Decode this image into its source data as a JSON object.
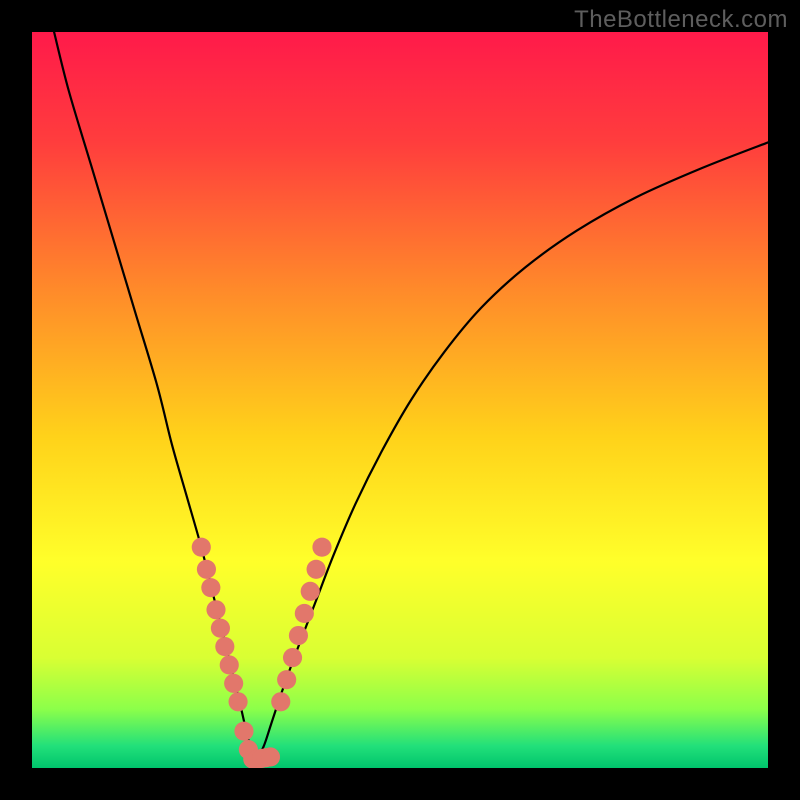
{
  "watermark": "TheBottleneck.com",
  "chart_data": {
    "type": "line",
    "title": "",
    "xlabel": "",
    "ylabel": "",
    "xlim": [
      0,
      100
    ],
    "ylim": [
      0,
      100
    ],
    "grid": false,
    "legend": false,
    "background_gradient": {
      "stops": [
        {
          "offset": 0.0,
          "color": "#ff1a4a"
        },
        {
          "offset": 0.15,
          "color": "#ff3d3d"
        },
        {
          "offset": 0.35,
          "color": "#ff8a2a"
        },
        {
          "offset": 0.55,
          "color": "#ffd21a"
        },
        {
          "offset": 0.72,
          "color": "#ffff2a"
        },
        {
          "offset": 0.85,
          "color": "#d9ff33"
        },
        {
          "offset": 0.92,
          "color": "#8cff4a"
        },
        {
          "offset": 0.97,
          "color": "#22e07a"
        },
        {
          "offset": 1.0,
          "color": "#00c46c"
        }
      ]
    },
    "series": [
      {
        "name": "bottleneck-curve",
        "color": "#000000",
        "x": [
          3,
          5,
          8,
          11,
          14,
          17,
          19,
          21,
          23,
          24.5,
          26,
          27.2,
          28.2,
          29,
          29.6,
          30,
          30.5,
          31.5,
          32.5,
          34,
          36,
          38.5,
          41,
          44,
          47.5,
          51.5,
          56,
          61,
          67,
          74,
          82,
          91,
          100
        ],
        "y": [
          100,
          92,
          82,
          72,
          62,
          52,
          44,
          37,
          30,
          24,
          18,
          13,
          9,
          5.5,
          3,
          1.2,
          1.2,
          3,
          6,
          10.5,
          16,
          22.5,
          29,
          36,
          43,
          50,
          56.5,
          62.5,
          68,
          73,
          77.5,
          81.5,
          85
        ]
      }
    ],
    "markers": {
      "name": "highlight-dots",
      "color": "#e2776b",
      "radius": 1.3,
      "points": [
        {
          "x": 23.0,
          "y": 30.0
        },
        {
          "x": 23.7,
          "y": 27.0
        },
        {
          "x": 24.3,
          "y": 24.5
        },
        {
          "x": 25.0,
          "y": 21.5
        },
        {
          "x": 25.6,
          "y": 19.0
        },
        {
          "x": 26.2,
          "y": 16.5
        },
        {
          "x": 26.8,
          "y": 14.0
        },
        {
          "x": 27.4,
          "y": 11.5
        },
        {
          "x": 28.0,
          "y": 9.0
        },
        {
          "x": 28.8,
          "y": 5.0
        },
        {
          "x": 29.4,
          "y": 2.5
        },
        {
          "x": 30.0,
          "y": 1.2
        },
        {
          "x": 30.6,
          "y": 1.2
        },
        {
          "x": 31.2,
          "y": 1.3
        },
        {
          "x": 31.8,
          "y": 1.4
        },
        {
          "x": 32.4,
          "y": 1.5
        },
        {
          "x": 33.8,
          "y": 9.0
        },
        {
          "x": 34.6,
          "y": 12.0
        },
        {
          "x": 35.4,
          "y": 15.0
        },
        {
          "x": 36.2,
          "y": 18.0
        },
        {
          "x": 37.0,
          "y": 21.0
        },
        {
          "x": 37.8,
          "y": 24.0
        },
        {
          "x": 38.6,
          "y": 27.0
        },
        {
          "x": 39.4,
          "y": 30.0
        }
      ]
    }
  }
}
